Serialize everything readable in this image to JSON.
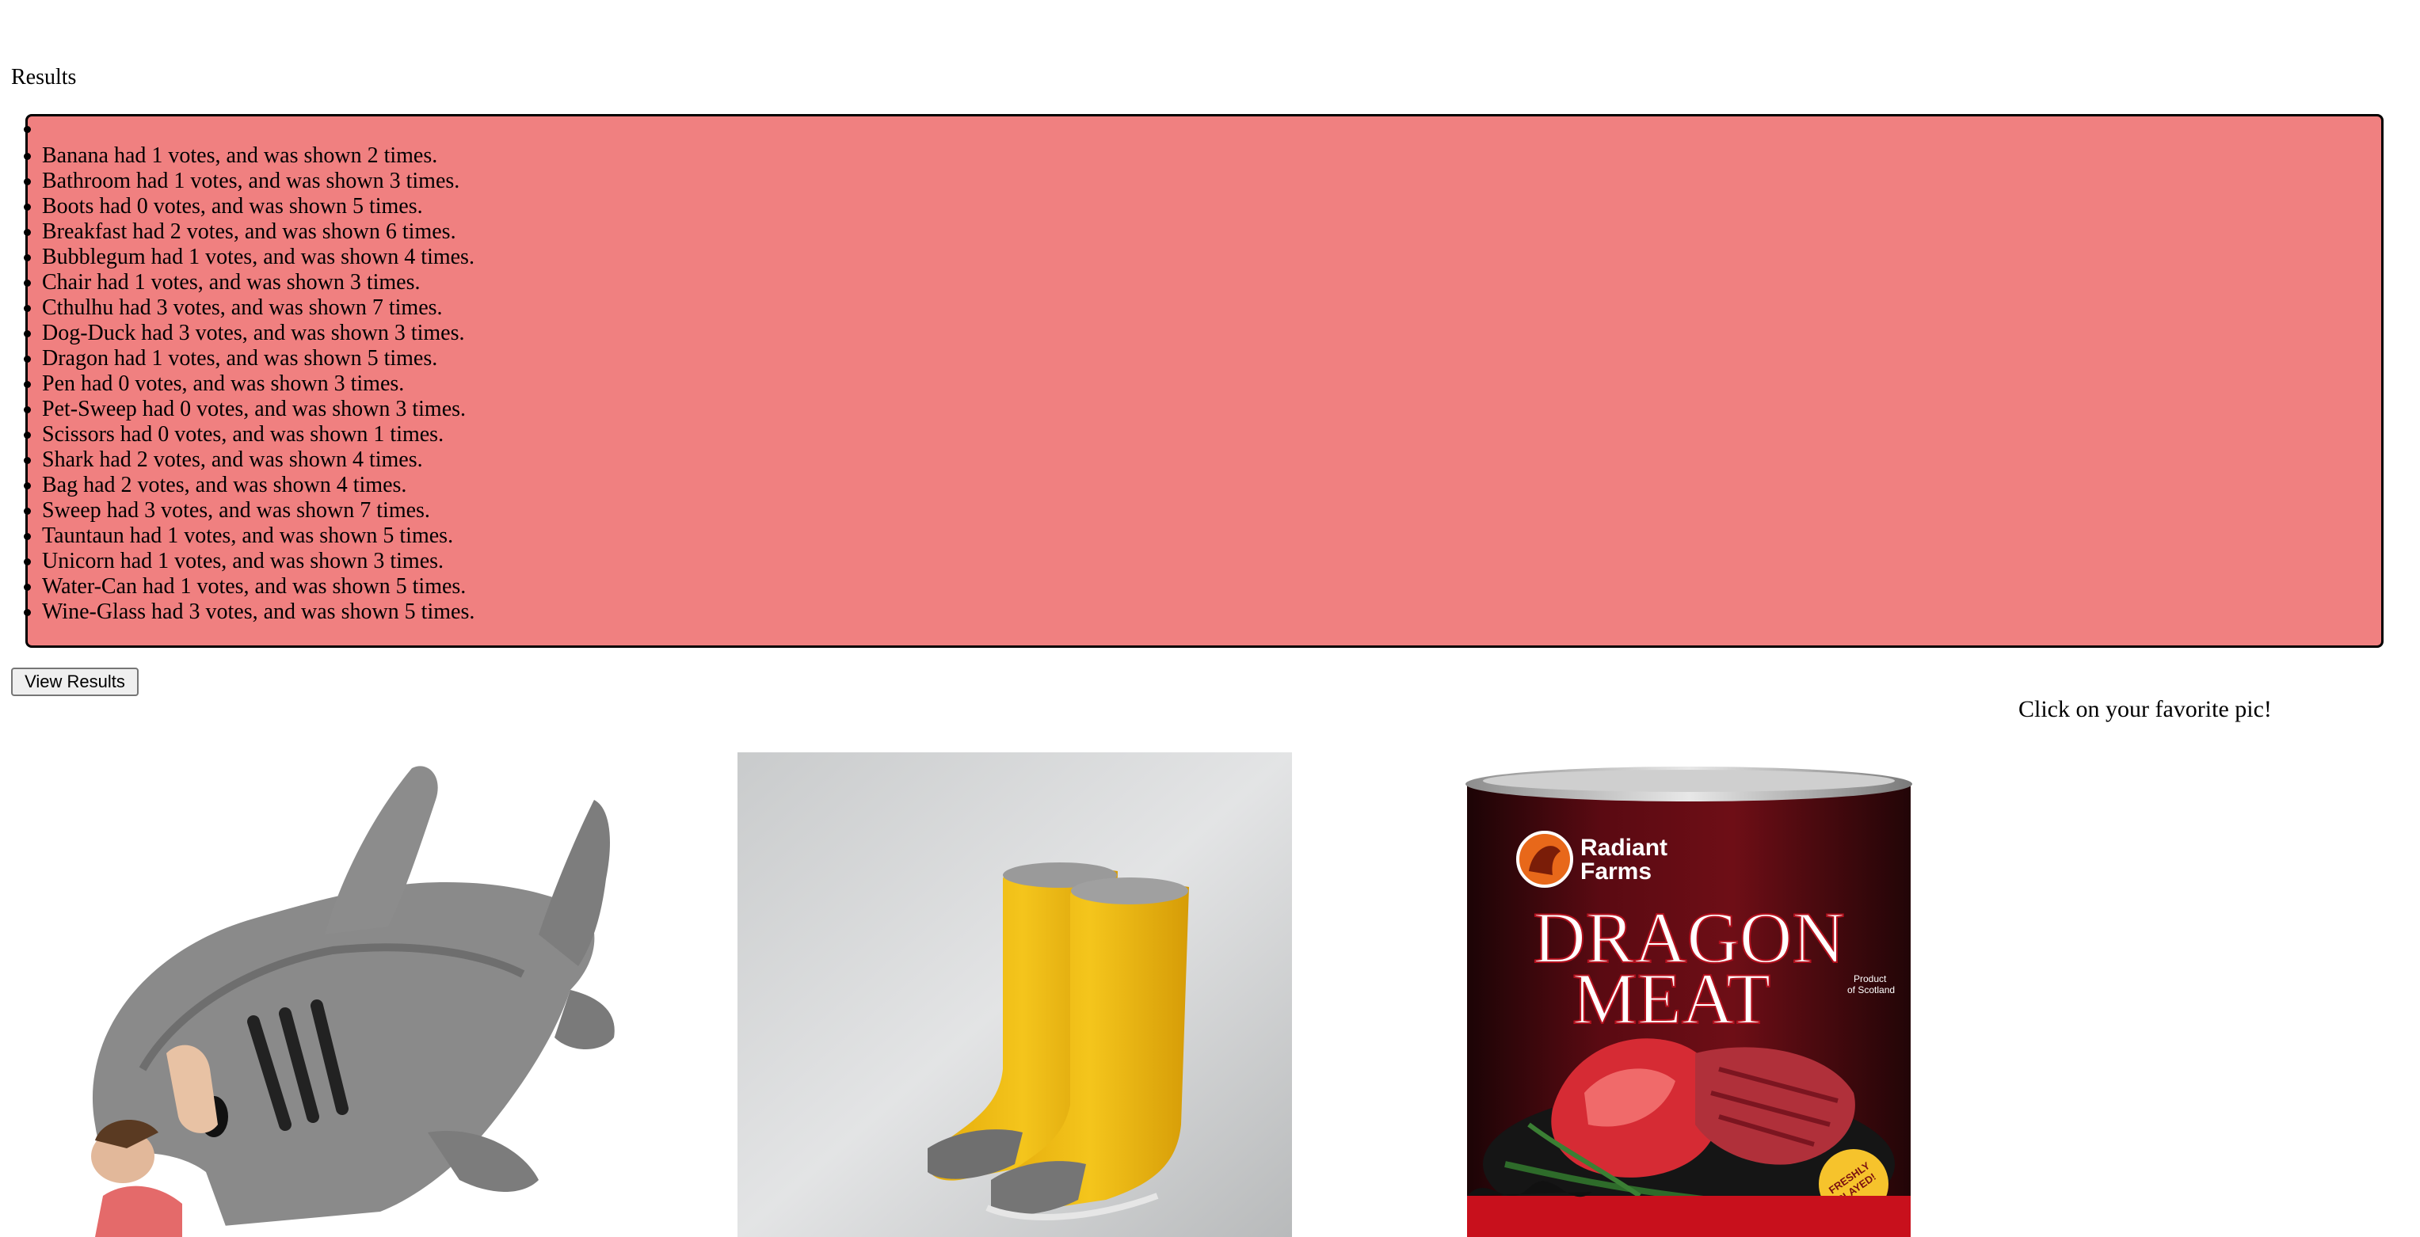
{
  "results": {
    "heading": "Results",
    "items": [
      "",
      "Banana had 1 votes, and was shown 2 times.",
      "Bathroom had 1 votes, and was shown 3 times.",
      "Boots had 0 votes, and was shown 5 times.",
      "Breakfast had 2 votes, and was shown 6 times.",
      "Bubblegum had 1 votes, and was shown 4 times.",
      "Chair had 1 votes, and was shown 3 times.",
      "Cthulhu had 3 votes, and was shown 7 times.",
      "Dog-Duck had 3 votes, and was shown 3 times.",
      "Dragon had 1 votes, and was shown 5 times.",
      "Pen had 0 votes, and was shown 3 times.",
      "Pet-Sweep had 0 votes, and was shown 3 times.",
      "Scissors had 0 votes, and was shown 1 times.",
      "Shark had 2 votes, and was shown 4 times.",
      "Bag had 2 votes, and was shown 4 times.",
      "Sweep had 3 votes, and was shown 7 times.",
      "Tauntaun had 1 votes, and was shown 5 times.",
      "Unicorn had 1 votes, and was shown 3 times.",
      "Water-Can had 1 votes, and was shown 5 times.",
      "Wine-Glass had 3 votes, and was shown 5 times."
    ],
    "box_color": "#f08080"
  },
  "controls": {
    "view_results_label": "View Results"
  },
  "vote": {
    "prompt": "Click on your favorite pic!",
    "images": [
      {
        "subject": "shark sleeping bag"
      },
      {
        "subject": "yellow rain boots"
      },
      {
        "subject": "dragon meat can",
        "brand": "Radiant Farms",
        "title_line1": "DRAGON",
        "title_line2": "MEAT",
        "tag": "Product of Scotland",
        "sticker": "FRESHLY SLAYED!"
      }
    ]
  }
}
